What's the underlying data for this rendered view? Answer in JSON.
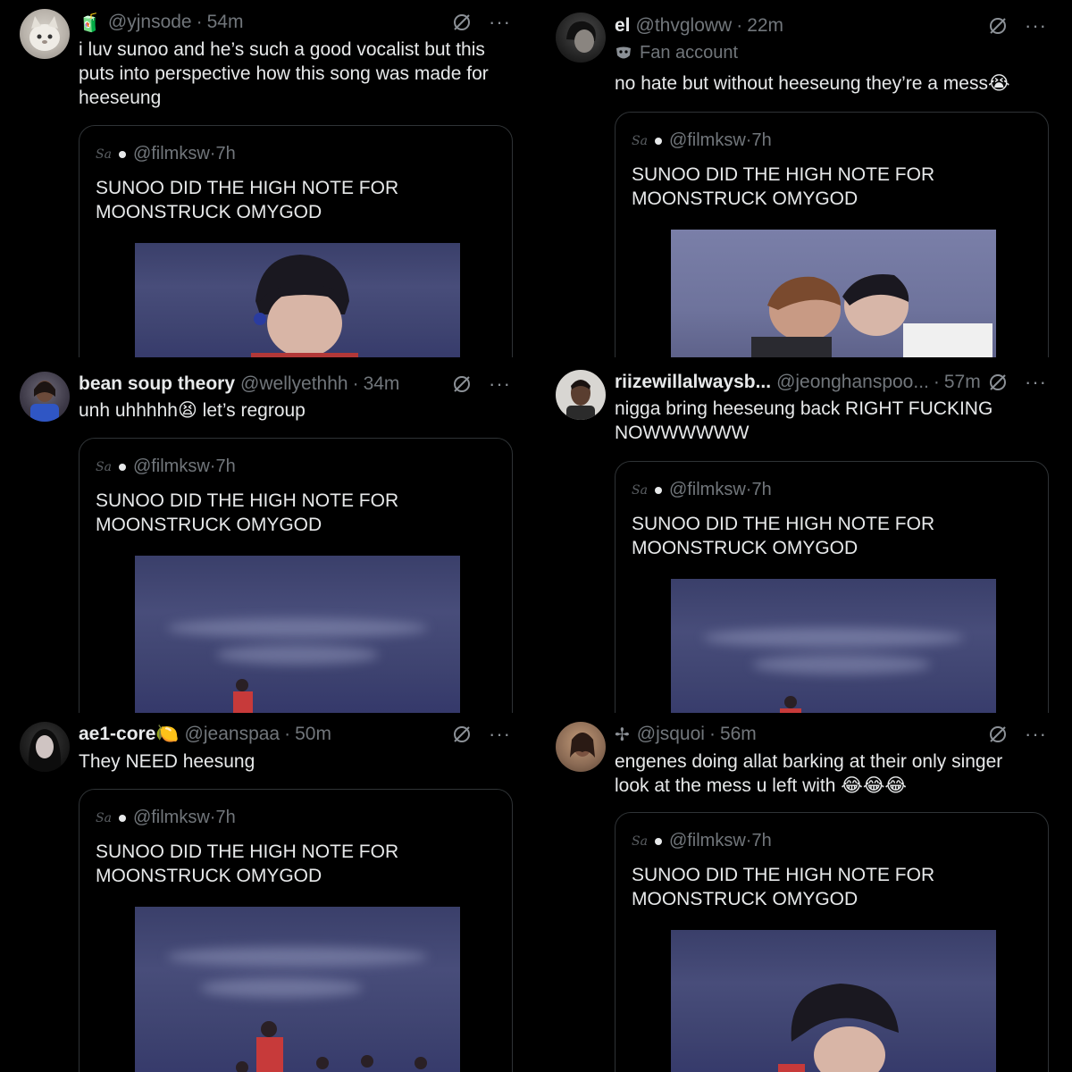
{
  "posts": [
    {
      "name": "",
      "handle": "@yjnsode",
      "time": "54m",
      "pre_icon": "🧃",
      "text": "i luv sunoo and he’s such a good vocalist but this puts into perspective how this song was made for heeseung"
    },
    {
      "name": "el",
      "handle": "@thvgloww",
      "time": "22m",
      "label": "Fan account",
      "text": "no hate but without heeseung they’re a mess😭"
    },
    {
      "name": "bean soup theory",
      "handle": "@wellyethhh",
      "time": "34m",
      "text": "unh uhhhhh😫 let’s regroup"
    },
    {
      "name": "riizewillalwaysb...",
      "handle": "@jeonghanspoo...",
      "time": "57m",
      "text": "nigga bring heeseung back RIGHT FUCKING NOWWWWWW"
    },
    {
      "name": "ae1-core🍋",
      "handle": "@jeanspaa",
      "time": "50m",
      "text": "They NEED heesung"
    },
    {
      "name": "",
      "handle": "@jsquoi",
      "time": "56m",
      "pre_icon": "✢",
      "text": "engenes doing allat barking at their only singer look at the mess u left with 😂😂😂"
    }
  ],
  "quoted": {
    "signature": "Sa",
    "handle": "@filmksw",
    "time": "7h",
    "text": "SUNOO DID THE HIGH NOTE FOR MOONSTRUCK OMYGOD"
  },
  "separator": "·",
  "more_glyph": "···",
  "colors": {
    "background": "#000000",
    "text": "#e7e9ea",
    "muted": "#71767b",
    "border": "#2f3336"
  },
  "icons": [
    "grok-slash-icon",
    "more-icon",
    "mask-icon",
    "avatar"
  ]
}
